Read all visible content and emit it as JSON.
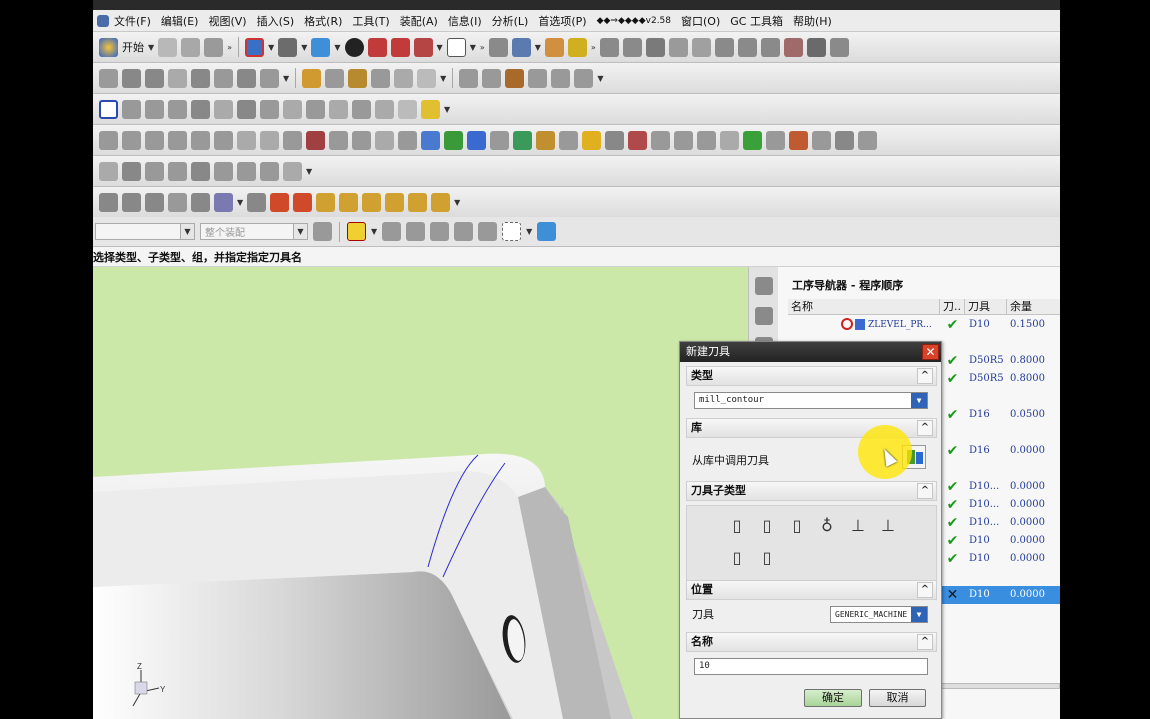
{
  "menubar": {
    "items": [
      "文件(F)",
      "编辑(E)",
      "视图(V)",
      "插入(S)",
      "格式(R)",
      "工具(T)",
      "装配(A)",
      "信息(I)",
      "分析(L)",
      "首选项(P)",
      "◆◆⇒◆◆◆◆v2.58",
      "窗口(O)",
      "GC 工具箱",
      "帮助(H)"
    ]
  },
  "toolbar": {
    "start_label": "开始"
  },
  "selection_bar": {
    "filter_placeholder": "",
    "scope_value": "整个装配"
  },
  "cue_line": "选择类型、子类型、组，并指定指定刀具名",
  "navigator": {
    "title": "工序导航器 - 程序顺序",
    "columns": [
      "名称",
      "刀..",
      "刀具",
      "余量"
    ],
    "rows": [
      {
        "name": "ZLEVEL_PR...",
        "status": "✔",
        "tool": "D10",
        "stock": "0.1500",
        "selected": false
      },
      {
        "name": "",
        "status": "✔",
        "tool": "D50R5",
        "stock": "0.8000",
        "selected": false
      },
      {
        "name": "",
        "status": "✔",
        "tool": "D50R5",
        "stock": "0.8000",
        "selected": false
      },
      {
        "name": "",
        "status": "✔",
        "tool": "D16",
        "stock": "0.0500",
        "selected": false
      },
      {
        "name": "",
        "status": "✔",
        "tool": "D16",
        "stock": "0.0000",
        "selected": false
      },
      {
        "name": "",
        "status": "✔",
        "tool": "D10...",
        "stock": "0.0000",
        "selected": false
      },
      {
        "name": "",
        "status": "✔",
        "tool": "D10...",
        "stock": "0.0000",
        "selected": false
      },
      {
        "name": "",
        "status": "✔",
        "tool": "D10...",
        "stock": "0.0000",
        "selected": false
      },
      {
        "name": "",
        "status": "✔",
        "tool": "D10",
        "stock": "0.0000",
        "selected": false
      },
      {
        "name": "",
        "status": "✔",
        "tool": "D10",
        "stock": "0.0000",
        "selected": false
      },
      {
        "name": "",
        "status": "✕",
        "tool": "D10",
        "stock": "0.0000",
        "selected": true
      }
    ]
  },
  "dialog": {
    "title": "新建刀具",
    "type_section": "类型",
    "type_value": "mill_contour",
    "library_section": "库",
    "library_label": "从库中调用刀具",
    "subtype_section": "刀具子类型",
    "location_section": "位置",
    "tool_label": "刀具",
    "tool_value": "GENERIC_MACHINE",
    "name_section": "名称",
    "name_value": "10",
    "ok_label": "确定",
    "cancel_label": "取消"
  },
  "colors": {
    "viewport_bg": "#cce8a8",
    "selection_highlight": "#3a8ee0",
    "dialog_title": "#2a2a2a",
    "close_button": "#d8432a",
    "check_green": "#1a9a1a"
  }
}
